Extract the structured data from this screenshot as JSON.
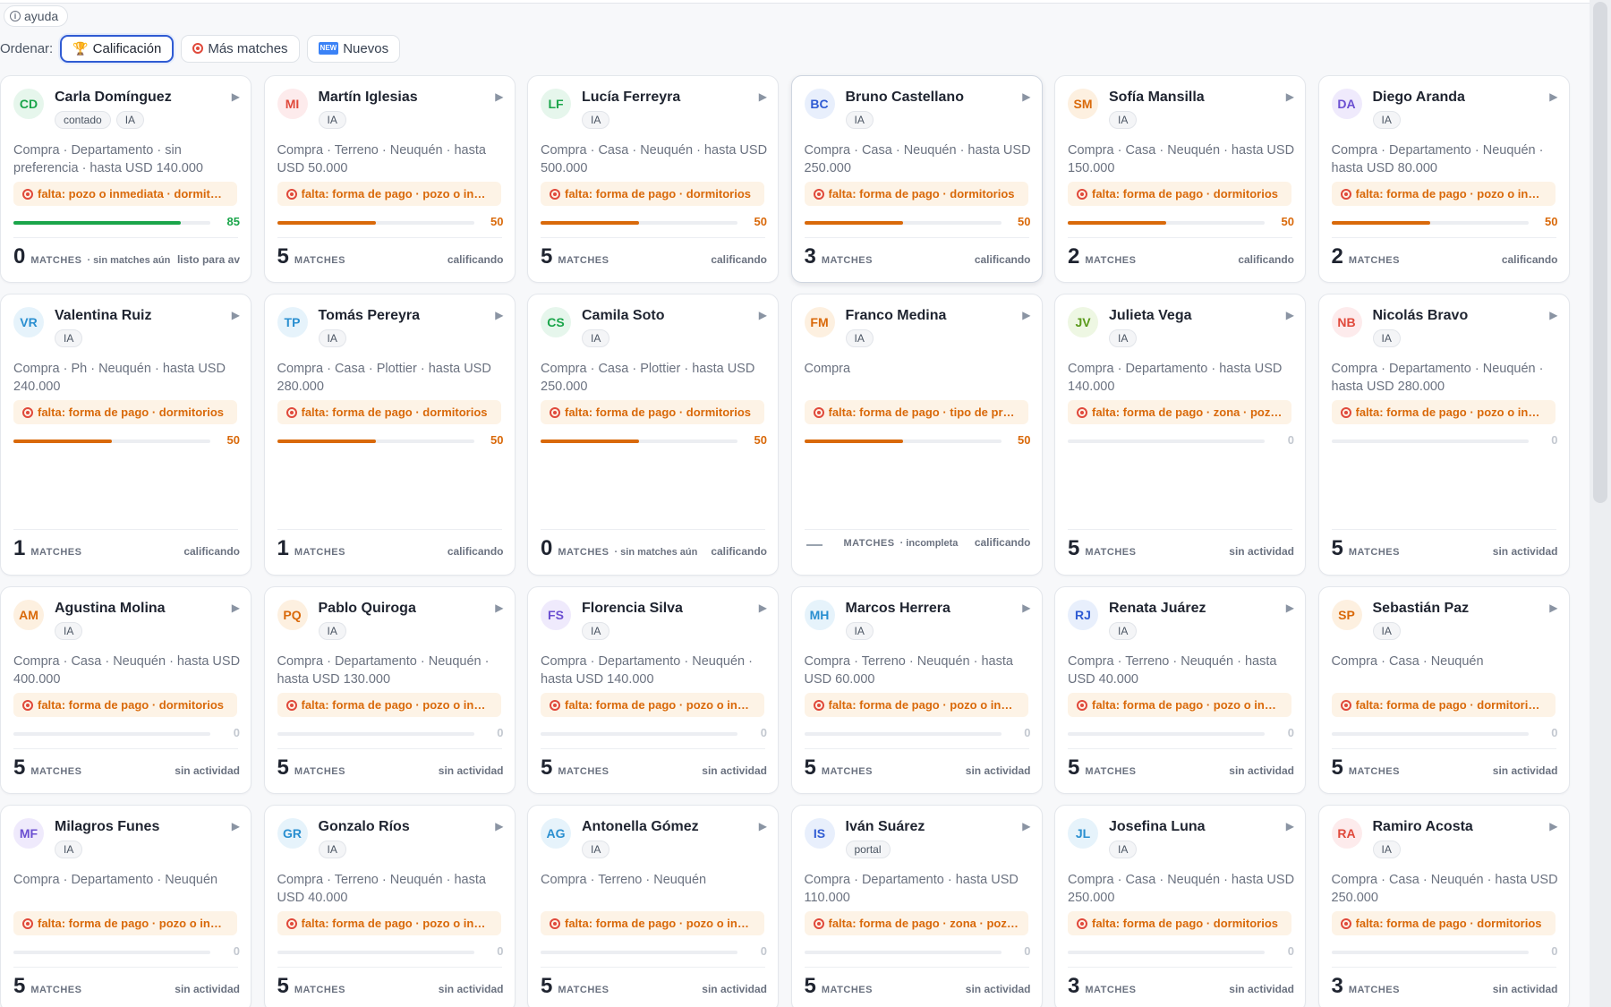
{
  "help": {
    "label": "ayuda"
  },
  "sort": {
    "label": "Ordenar:",
    "options": [
      {
        "label": "Calificación",
        "icon": "trophy-icon",
        "active": true
      },
      {
        "label": "Más matches",
        "icon": "target-icon",
        "active": false
      },
      {
        "label": "Nuevos",
        "icon": "new-icon",
        "active": false
      }
    ]
  },
  "matches_label": "MATCHES",
  "colors": {
    "green": "#1aa54a",
    "orange": "#d9690a",
    "accent": "#2f5bd3",
    "missing_text": "#d9690a"
  },
  "leads": [
    {
      "initials": "CD",
      "name": "Carla Domínguez",
      "tags": [
        "contado",
        "IA"
      ],
      "desc": "Compra · Departamento · sin preferencia · hasta USD 140.000",
      "missing": "falta: pozo o inmediata · dormitorios",
      "score": 85,
      "matches": "0",
      "note": "· sin matches aún",
      "status": "listo para av",
      "avatar_bg": "#e6f6ec",
      "avatar_fg": "#1aa54a"
    },
    {
      "initials": "MI",
      "name": "Martín Iglesias",
      "tags": [
        "IA"
      ],
      "desc": "Compra · Terreno · Neuquén · hasta USD 50.000",
      "missing": "falta: forma de pago · pozo o inmediata",
      "score": 50,
      "matches": "5",
      "note": "",
      "status": "calificando",
      "avatar_bg": "#fdebec",
      "avatar_fg": "#e0493b"
    },
    {
      "initials": "LF",
      "name": "Lucía Ferreyra",
      "tags": [
        "IA"
      ],
      "desc": "Compra · Casa · Neuquén · hasta USD 500.000",
      "missing": "falta: forma de pago · dormitorios",
      "score": 50,
      "matches": "5",
      "note": "",
      "status": "calificando",
      "avatar_bg": "#e6f6ec",
      "avatar_fg": "#1aa54a"
    },
    {
      "initials": "BC",
      "name": "Bruno Castellano",
      "tags": [
        "IA"
      ],
      "desc": "Compra · Casa · Neuquén · hasta USD 250.000",
      "missing": "falta: forma de pago · dormitorios",
      "score": 50,
      "matches": "3",
      "note": "",
      "status": "calificando",
      "avatar_bg": "#e8effc",
      "avatar_fg": "#2f5bd3",
      "hl": true
    },
    {
      "initials": "SM",
      "name": "Sofía Mansilla",
      "tags": [
        "IA"
      ],
      "desc": "Compra · Casa · Neuquén · hasta USD 150.000",
      "missing": "falta: forma de pago · dormitorios",
      "score": 50,
      "matches": "2",
      "note": "",
      "status": "calificando",
      "avatar_bg": "#fdf0e0",
      "avatar_fg": "#d9690a"
    },
    {
      "initials": "DA",
      "name": "Diego Aranda",
      "tags": [
        "IA"
      ],
      "desc": "Compra · Departamento · Neuquén · hasta USD 80.000",
      "missing": "falta: forma de pago · pozo o inmediata",
      "score": 50,
      "matches": "2",
      "note": "",
      "status": "calificando",
      "avatar_bg": "#efeafc",
      "avatar_fg": "#6b4fd1"
    },
    {
      "initials": "VR",
      "name": "Valentina Ruiz",
      "tags": [
        "IA"
      ],
      "desc": "Compra · Ph · Neuquén · hasta USD 240.000",
      "missing": "falta: forma de pago · dormitorios",
      "score": 50,
      "matches": "1",
      "note": "",
      "status": "calificando",
      "avatar_bg": "#e6f3fb",
      "avatar_fg": "#2a8fd0"
    },
    {
      "initials": "TP",
      "name": "Tomás Pereyra",
      "tags": [
        "IA"
      ],
      "desc": "Compra · Casa · Plottier · hasta USD 280.000",
      "missing": "falta: forma de pago · dormitorios",
      "score": 50,
      "matches": "1",
      "note": "",
      "status": "calificando",
      "avatar_bg": "#e6f3fb",
      "avatar_fg": "#2a8fd0"
    },
    {
      "initials": "CS",
      "name": "Camila Soto",
      "tags": [
        "IA"
      ],
      "desc": "Compra · Casa · Plottier · hasta USD 250.000",
      "missing": "falta: forma de pago · dormitorios",
      "score": 50,
      "matches": "0",
      "note": "· sin matches aún",
      "status": "calificando",
      "avatar_bg": "#e6f6ec",
      "avatar_fg": "#1aa54a"
    },
    {
      "initials": "FM",
      "name": "Franco Medina",
      "tags": [
        "IA"
      ],
      "desc": "Compra",
      "missing": "falta: forma de pago · tipo de propiedad",
      "score": 50,
      "matches": "",
      "note": "· incompleta",
      "status": "calificando",
      "avatar_bg": "#fdf0e0",
      "avatar_fg": "#d9690a"
    },
    {
      "initials": "JV",
      "name": "Julieta Vega",
      "tags": [
        "IA"
      ],
      "desc": "Compra · Departamento · hasta USD 140.000",
      "missing": "falta: forma de pago · zona · pozo o inmediata",
      "score": 0,
      "matches": "5",
      "note": "",
      "status": "sin actividad",
      "avatar_bg": "#eef7e3",
      "avatar_fg": "#5a9a1b"
    },
    {
      "initials": "NB",
      "name": "Nicolás Bravo",
      "tags": [
        "IA"
      ],
      "desc": "Compra · Departamento · Neuquén · hasta USD 280.000",
      "missing": "falta: forma de pago · pozo o inmediata",
      "score": 0,
      "matches": "5",
      "note": "",
      "status": "sin actividad",
      "avatar_bg": "#fdebec",
      "avatar_fg": "#e0493b"
    },
    {
      "initials": "AM",
      "name": "Agustina Molina",
      "tags": [
        "IA"
      ],
      "desc": "Compra · Casa · Neuquén · hasta USD 400.000",
      "missing": "falta: forma de pago · dormitorios",
      "score": 0,
      "matches": "5",
      "note": "",
      "status": "sin actividad",
      "avatar_bg": "#fdf0e0",
      "avatar_fg": "#d9690a"
    },
    {
      "initials": "PQ",
      "name": "Pablo Quiroga",
      "tags": [
        "IA"
      ],
      "desc": "Compra · Departamento · Neuquén · hasta USD 130.000",
      "missing": "falta: forma de pago · pozo o inmediata",
      "score": 0,
      "matches": "5",
      "note": "",
      "status": "sin actividad",
      "avatar_bg": "#fdf0e0",
      "avatar_fg": "#d9690a"
    },
    {
      "initials": "FS",
      "name": "Florencia Silva",
      "tags": [
        "IA"
      ],
      "desc": "Compra · Departamento · Neuquén · hasta USD 140.000",
      "missing": "falta: forma de pago · pozo o inmediata",
      "score": 0,
      "matches": "5",
      "note": "",
      "status": "sin actividad",
      "avatar_bg": "#efeafc",
      "avatar_fg": "#6b4fd1"
    },
    {
      "initials": "MH",
      "name": "Marcos Herrera",
      "tags": [
        "IA"
      ],
      "desc": "Compra · Terreno · Neuquén · hasta USD 60.000",
      "missing": "falta: forma de pago · pozo o inmediata",
      "score": 0,
      "matches": "5",
      "note": "",
      "status": "sin actividad",
      "avatar_bg": "#e6f3fb",
      "avatar_fg": "#2a8fd0"
    },
    {
      "initials": "RJ",
      "name": "Renata Juárez",
      "tags": [
        "IA"
      ],
      "desc": "Compra · Terreno · Neuquén · hasta USD 40.000",
      "missing": "falta: forma de pago · pozo o inmediata",
      "score": 0,
      "matches": "5",
      "note": "",
      "status": "sin actividad",
      "avatar_bg": "#e8effc",
      "avatar_fg": "#2f5bd3"
    },
    {
      "initials": "SP",
      "name": "Sebastián Paz",
      "tags": [
        "IA"
      ],
      "desc": "Compra · Casa · Neuquén",
      "missing": "falta: forma de pago · dormitorios · pozo",
      "score": 0,
      "matches": "5",
      "note": "",
      "status": "sin actividad",
      "avatar_bg": "#fdf0e0",
      "avatar_fg": "#d9690a"
    },
    {
      "initials": "MF",
      "name": "Milagros Funes",
      "tags": [
        "IA"
      ],
      "desc": "Compra · Departamento · Neuquén",
      "missing": "falta: forma de pago · pozo o inmediata",
      "score": 0,
      "matches": "5",
      "note": "",
      "status": "sin actividad",
      "avatar_bg": "#efeafc",
      "avatar_fg": "#6b4fd1"
    },
    {
      "initials": "GR",
      "name": "Gonzalo Ríos",
      "tags": [
        "IA"
      ],
      "desc": "Compra · Terreno · Neuquén · hasta USD 40.000",
      "missing": "falta: forma de pago · pozo o inmediata",
      "score": 0,
      "matches": "5",
      "note": "",
      "status": "sin actividad",
      "avatar_bg": "#e6f3fb",
      "avatar_fg": "#2a8fd0"
    },
    {
      "initials": "AG",
      "name": "Antonella Gómez",
      "tags": [
        "IA"
      ],
      "desc": "Compra · Terreno · Neuquén",
      "missing": "falta: forma de pago · pozo o inmediata",
      "score": 0,
      "matches": "5",
      "note": "",
      "status": "sin actividad",
      "avatar_bg": "#e6f3fb",
      "avatar_fg": "#2a8fd0"
    },
    {
      "initials": "IS",
      "name": "Iván Suárez",
      "tags": [
        "portal"
      ],
      "desc": "Compra · Departamento · hasta USD 110.000",
      "missing": "falta: forma de pago · zona · pozo o inmediata",
      "score": 0,
      "matches": "5",
      "note": "",
      "status": "sin actividad",
      "avatar_bg": "#e8effc",
      "avatar_fg": "#2f5bd3"
    },
    {
      "initials": "JL",
      "name": "Josefina Luna",
      "tags": [
        "IA"
      ],
      "desc": "Compra · Casa · Neuquén · hasta USD 250.000",
      "missing": "falta: forma de pago · dormitorios",
      "score": 0,
      "matches": "3",
      "note": "",
      "status": "sin actividad",
      "avatar_bg": "#e6f3fb",
      "avatar_fg": "#2a8fd0"
    },
    {
      "initials": "RA",
      "name": "Ramiro Acosta",
      "tags": [
        "IA"
      ],
      "desc": "Compra · Casa · Neuquén · hasta USD 250.000",
      "missing": "falta: forma de pago · dormitorios",
      "score": 0,
      "matches": "3",
      "note": "",
      "status": "sin actividad",
      "avatar_bg": "#fdebec",
      "avatar_fg": "#e0493b"
    }
  ]
}
